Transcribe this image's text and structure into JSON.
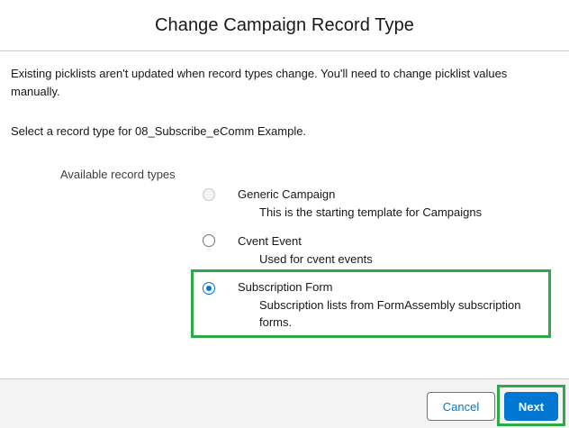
{
  "dialog": {
    "title": "Change Campaign Record Type",
    "notice": "Existing picklists aren't updated when record types change. You'll need to change picklist values manually.",
    "prompt": "Select a record type for 08_Subscribe_eComm Example.",
    "available_label": "Available record types"
  },
  "record_types": [
    {
      "title": "Generic Campaign",
      "description": "This is the starting template for Campaigns",
      "state": "disabled"
    },
    {
      "title": "Cvent Event",
      "description": "Used for cvent events",
      "state": "unselected"
    },
    {
      "title": "Subscription Form",
      "description": "Subscription lists from FormAssembly subscription forms.",
      "state": "selected"
    }
  ],
  "footer": {
    "cancel_label": "Cancel",
    "next_label": "Next"
  },
  "colors": {
    "brand": "#0176d3",
    "highlight": "#2eaa4a"
  }
}
